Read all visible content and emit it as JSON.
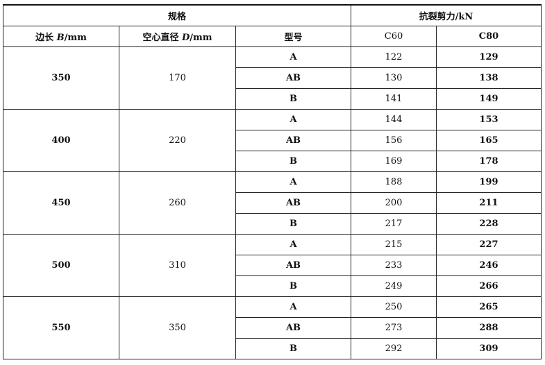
{
  "header": {
    "group_spec": "规格",
    "group_shear": "抗裂剪力/kN",
    "col_side": "边长",
    "col_side_var": "B",
    "col_side_unit": "/mm",
    "col_hollow": "空心直径",
    "col_hollow_var": "D",
    "col_hollow_unit": "/mm",
    "col_type": "型号",
    "col_c60": "C60",
    "col_c80": "C80"
  },
  "groups": [
    {
      "side": "350",
      "hollow": "170",
      "rows": [
        {
          "type": "A",
          "c60": "122",
          "c80": "129"
        },
        {
          "type": "AB",
          "c60": "130",
          "c80": "138"
        },
        {
          "type": "B",
          "c60": "141",
          "c80": "149"
        }
      ]
    },
    {
      "side": "400",
      "hollow": "220",
      "rows": [
        {
          "type": "A",
          "c60": "144",
          "c80": "153"
        },
        {
          "type": "AB",
          "c60": "156",
          "c80": "165"
        },
        {
          "type": "B",
          "c60": "169",
          "c80": "178"
        }
      ]
    },
    {
      "side": "450",
      "hollow": "260",
      "rows": [
        {
          "type": "A",
          "c60": "188",
          "c80": "199"
        },
        {
          "type": "AB",
          "c60": "200",
          "c80": "211"
        },
        {
          "type": "B",
          "c60": "217",
          "c80": "228"
        }
      ]
    },
    {
      "side": "500",
      "hollow": "310",
      "rows": [
        {
          "type": "A",
          "c60": "215",
          "c80": "227"
        },
        {
          "type": "AB",
          "c60": "233",
          "c80": "246"
        },
        {
          "type": "B",
          "c60": "249",
          "c80": "266"
        }
      ]
    },
    {
      "side": "550",
      "hollow": "350",
      "rows": [
        {
          "type": "A",
          "c60": "250",
          "c80": "265"
        },
        {
          "type": "AB",
          "c60": "273",
          "c80": "288"
        },
        {
          "type": "B",
          "c60": "292",
          "c80": "309"
        }
      ]
    }
  ]
}
